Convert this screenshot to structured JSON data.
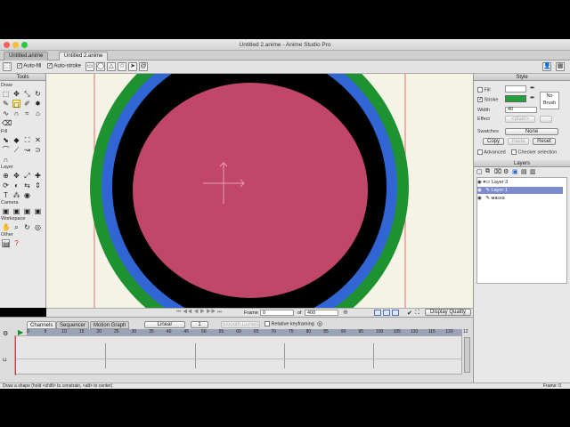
{
  "window": {
    "title": "Untitled 2.anime - Anime Studio Pro",
    "tabs": [
      {
        "label": "Untitled.anime",
        "active": false
      },
      {
        "label": "Untitled 2.anime",
        "active": true
      }
    ]
  },
  "toolbar": {
    "auto_fill": {
      "label": "Auto-fill",
      "checked": true
    },
    "auto_stroke": {
      "label": "Auto-stroke",
      "checked": true
    }
  },
  "tools_panel": {
    "title": "Tools",
    "sections": {
      "draw": "Draw",
      "fill": "Fill",
      "layer": "Layer",
      "camera": "Camera",
      "workspace": "Workspace",
      "other": "Other"
    }
  },
  "style_panel": {
    "title": "Style",
    "fill_label": "Fill",
    "fill_checked": false,
    "fill_color": "#ffffff",
    "stroke_label": "Stroke",
    "stroke_checked": true,
    "stroke_color": "#22a03a",
    "no_brush_line1": "No",
    "no_brush_line2": "Brush",
    "width_label": "Width",
    "width_value": "40",
    "effect_label": "Effect",
    "effect_value": "<plain>",
    "swatches_label": "Swatches",
    "swatches_value": "None",
    "copy_label": "Copy",
    "paste_label": "Paste",
    "reset_label": "Reset",
    "advanced_label": "Advanced",
    "checker_label": "Checker selection"
  },
  "layers_panel": {
    "title": "Layers",
    "items": [
      {
        "name": "Layer 3",
        "type": "group",
        "selected": false
      },
      {
        "name": "Layer 1",
        "type": "vector",
        "selected": true
      },
      {
        "name": "маска",
        "type": "vector",
        "selected": false
      }
    ]
  },
  "canvas_controls": {
    "frame_label": "Frame",
    "frame_value": "0",
    "of_label": "of",
    "total_frames": "400",
    "display_quality": "Display Quality"
  },
  "timeline": {
    "tabs": [
      "Channels",
      "Sequencer",
      "Motion Graph"
    ],
    "active_tab": "Channels",
    "interp_value": "Linear",
    "interp_amount": "1",
    "smooth_label": "Smooth Curves",
    "relative_keyframing_label": "Relative keyframing",
    "ruler_labels": [
      "0",
      "5",
      "10",
      "15",
      "20",
      "25",
      "30",
      "35",
      "40",
      "45",
      "50",
      "55",
      "60",
      "65",
      "70",
      "75",
      "80",
      "85",
      "90",
      "95",
      "100",
      "105",
      "110",
      "115",
      "120",
      "12"
    ]
  },
  "status": {
    "hint": "Draw a shape (hold <shift> to constrain, <alt> to center)",
    "frame_readout": "Frame: 0"
  },
  "colors": {
    "outer_ring": "#1e9130",
    "mid_ring": "#3265d4",
    "inner_ring": "#000000",
    "fill": "#c04767",
    "canvas_bg": "#f4f3e6",
    "guide": "#e05050"
  }
}
